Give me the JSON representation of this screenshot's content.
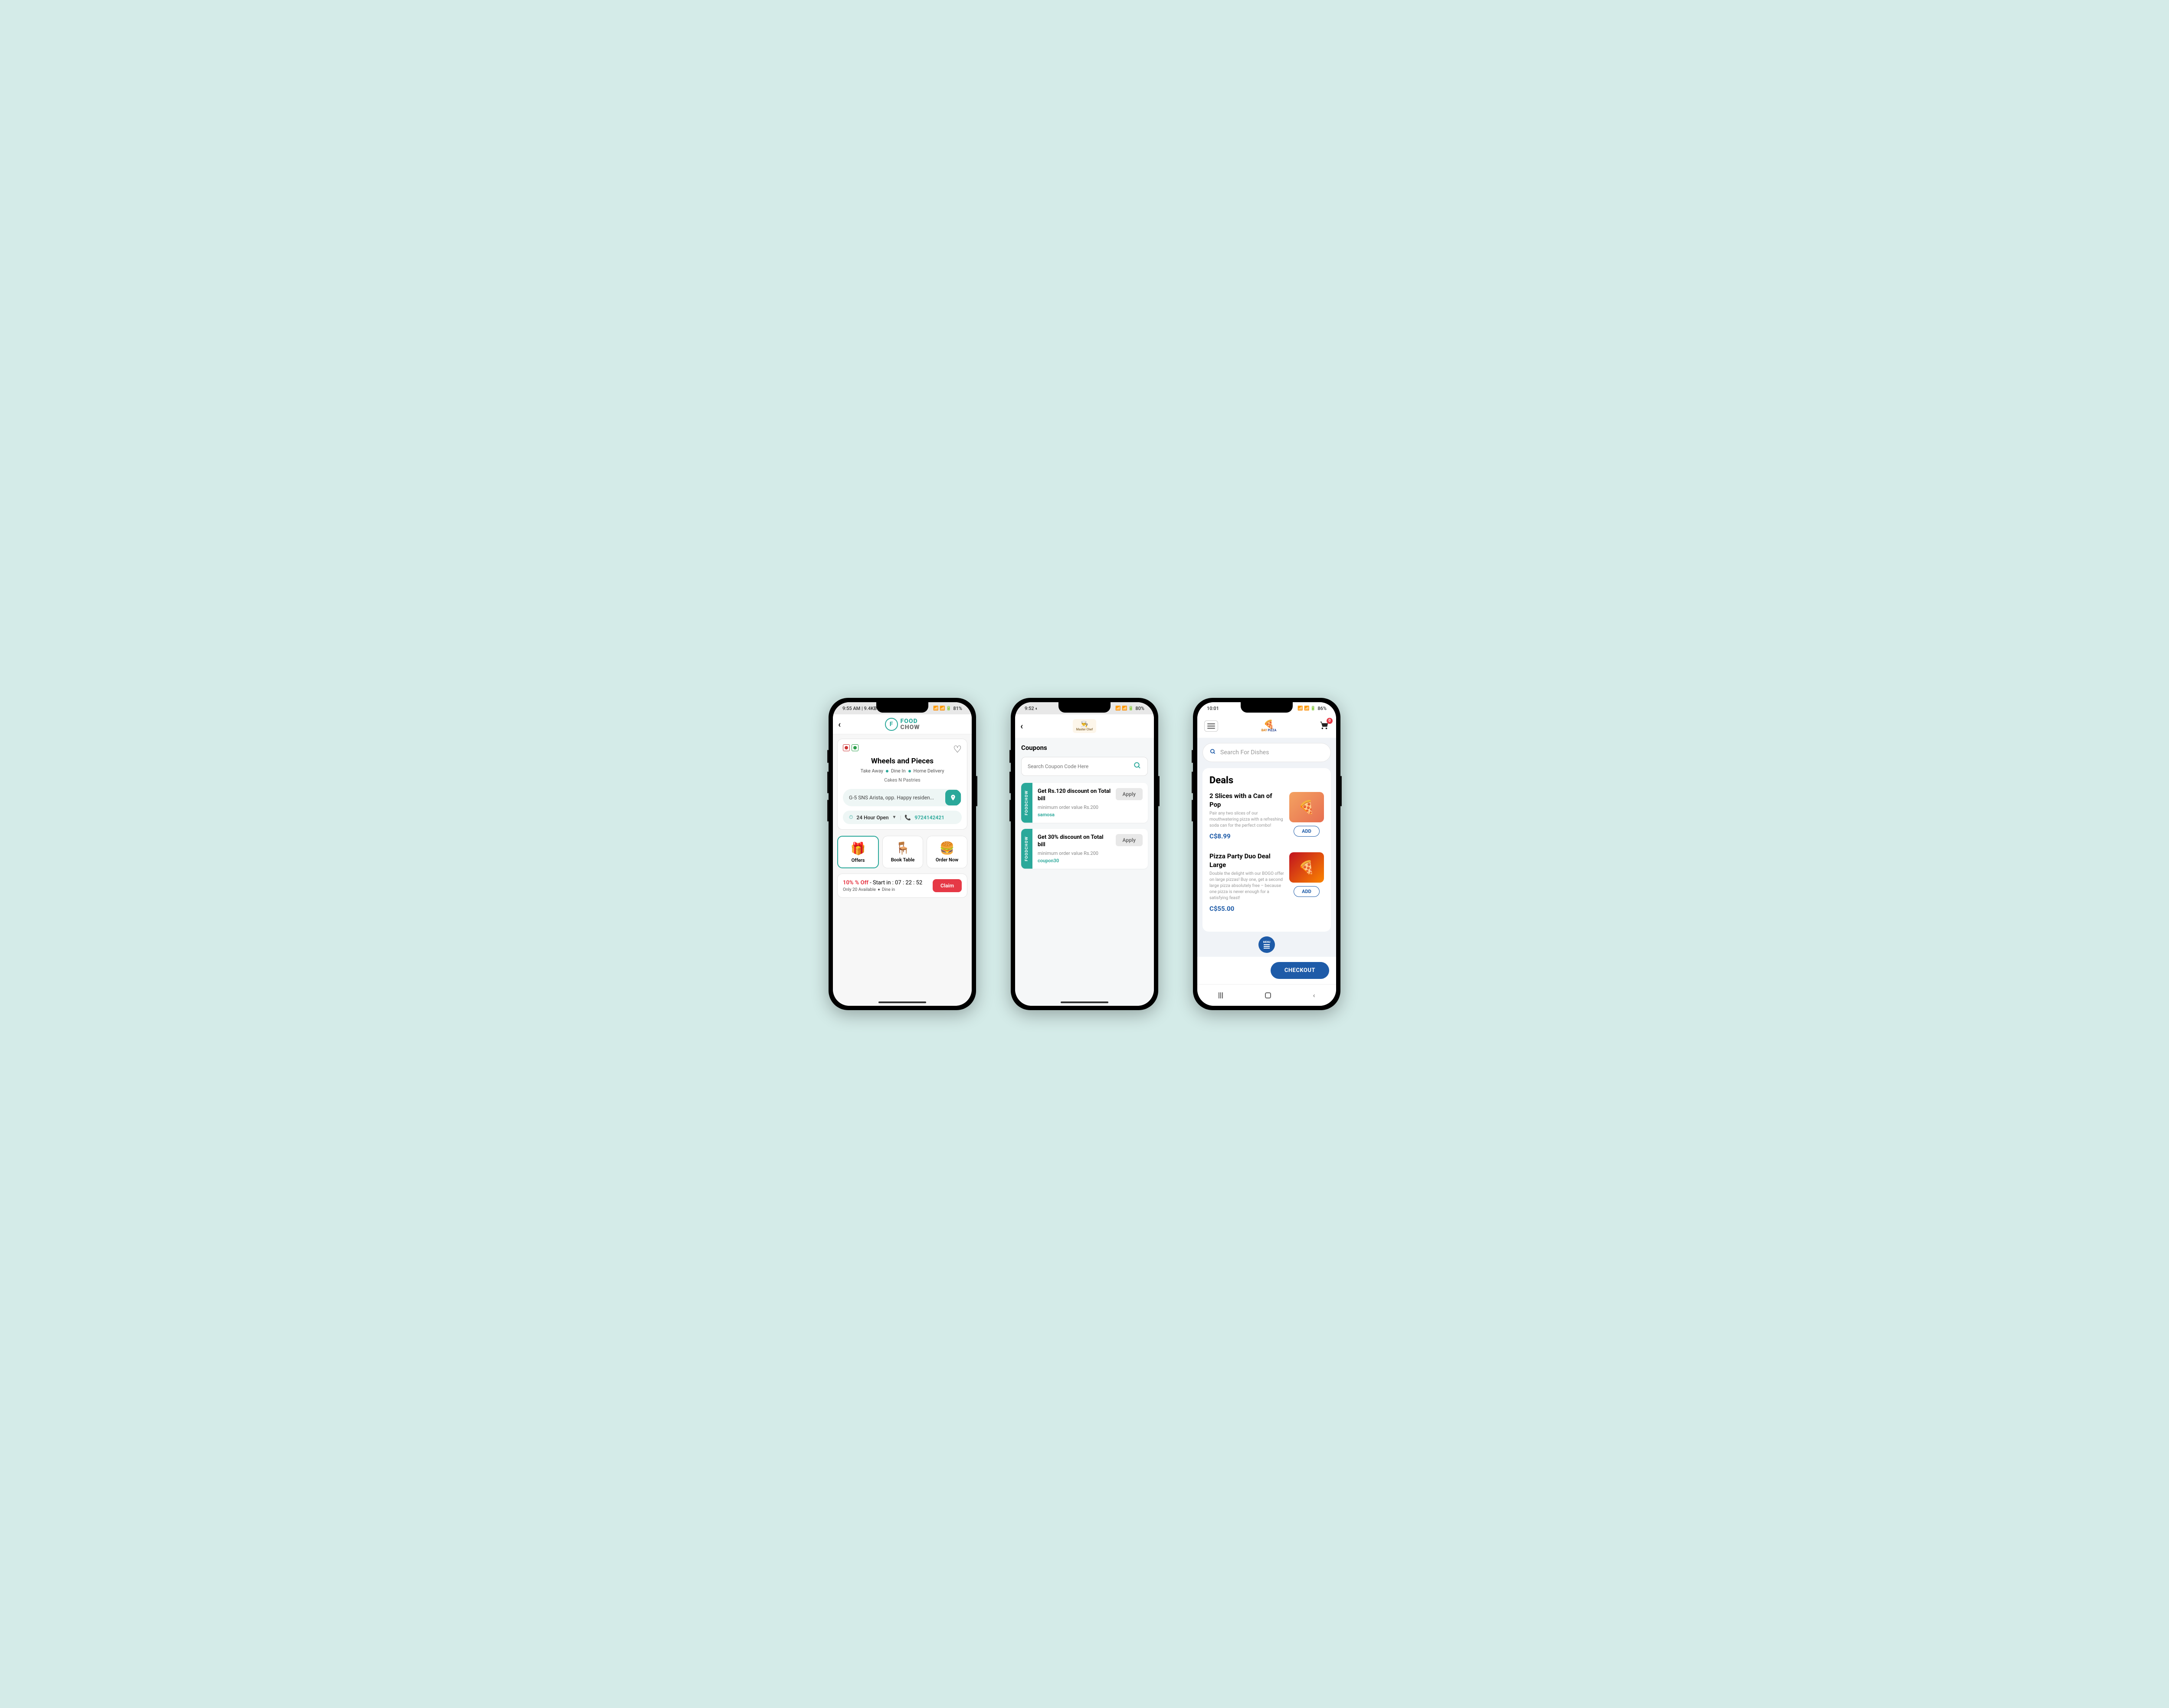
{
  "phone1": {
    "status": {
      "left": "9:55 AM | 9.4KB",
      "battery": "81%"
    },
    "logo": {
      "food": "FOOD",
      "chow": "CHOW"
    },
    "restaurant": {
      "name": "Wheels and Pieces",
      "services": [
        "Take Away",
        "Dine In",
        "Home Delivery"
      ],
      "category": "Cakes N Pastries",
      "address": "G-5 SNS Arista, opp. Happy residen...",
      "hours": "24 Hour Open",
      "phone": "9724142421"
    },
    "actions": [
      {
        "label": "Offers",
        "active": true
      },
      {
        "label": "Book Table",
        "active": false
      },
      {
        "label": "Order Now",
        "active": false
      }
    ],
    "offer": {
      "percent": "10% % Off",
      "timer": "- Start in : 07 : 22 : 52",
      "availability": "Only 20 Available",
      "mode": "Dine in",
      "claim": "Claim"
    }
  },
  "phone2": {
    "status": {
      "left": "9:52",
      "battery": "80%"
    },
    "logo_text": "Master Chef",
    "title": "Coupons",
    "search_placeholder": "Search Coupon Code Here",
    "side_label": "FOODCHOW",
    "apply_label": "Apply",
    "coupons": [
      {
        "title": "Get Rs.120 discount on Total bill",
        "min": "minimum order value Rs.200",
        "code": "samosa"
      },
      {
        "title": "Get 30% discount on Total bill",
        "min": "minimum order value Rs.200",
        "code": "coupon30"
      }
    ]
  },
  "phone3": {
    "status": {
      "left": "10:01",
      "battery": "86%"
    },
    "logo": {
      "bay": "BAY",
      "pizza": "PIZZA"
    },
    "cart_count": "0",
    "search_placeholder": "Search For Dishes",
    "deals_title": "Deals",
    "add_label": "ADD",
    "menu_label": "MENU",
    "checkout": "CHECKOUT",
    "deals": [
      {
        "name": "2 Slices with a Can of Pop",
        "desc": "Pair any two slices of our mouthwatering pizza with a refreshing soda can for the perfect combo!",
        "price": "C$8.99"
      },
      {
        "name": "Pizza Party Duo Deal Large",
        "desc": "Double the delight with our BOGO offer on large pizzas! Buy one, get a second large pizza absolutely free – because one pizza is never enough for a satisfying feast!",
        "price": "C$55.00"
      }
    ]
  }
}
